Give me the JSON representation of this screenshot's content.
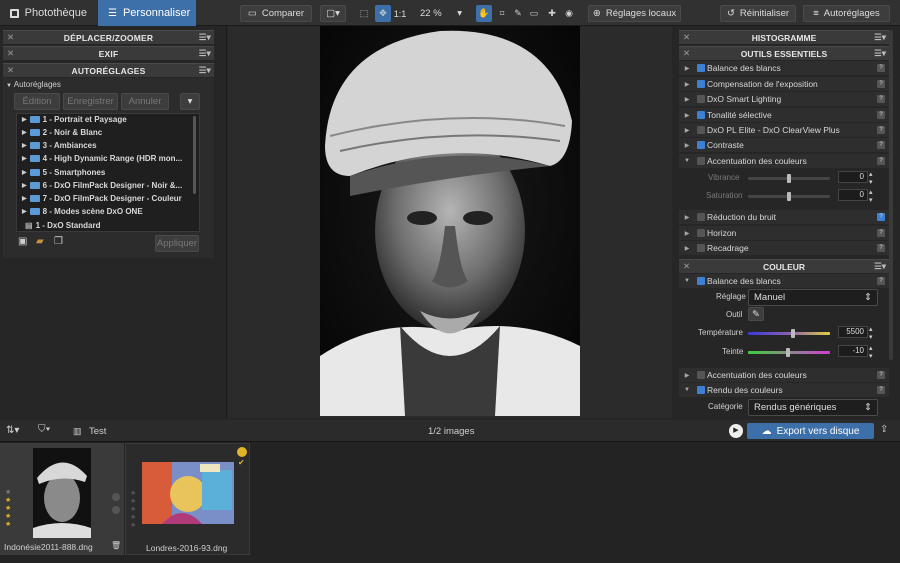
{
  "tabs": {
    "library": "Photothèque",
    "customize": "Personnaliser"
  },
  "toolbar": {
    "compare": "Comparer",
    "one_to_one": "1:1",
    "zoom": "22 %",
    "local": "Réglages locaux",
    "reset": "Réinitialiser",
    "auto": "Autoréglages"
  },
  "left": {
    "move_zoom": "DÉPLACER/ZOOMER",
    "exif": "EXIF",
    "autosettings": "AUTORÉGLAGES",
    "tree_root": "Autoréglages",
    "edit": "Édition",
    "save": "Enregistrer",
    "cancel": "Annuler",
    "presets": [
      "1 - Portrait et Paysage",
      "2 - Noir & Blanc",
      "3 - Ambiances",
      "4 - High Dynamic Range (HDR mon...",
      "5 - Smartphones",
      "6 - DxO FilmPack Designer - Noir &...",
      "7 - DxO FilmPack Designer - Couleur",
      "8 - Modes scène DxO ONE",
      "1 - DxO Standard"
    ],
    "apply": "Appliquer"
  },
  "right": {
    "histogram": "HISTOGRAMME",
    "essentials": "OUTILS ESSENTIELS",
    "ess_rows": [
      "Balance des blancs",
      "Compensation de l'exposition",
      "DxO Smart Lighting",
      "Tonalité sélective",
      "DxO PL Elite - DxO ClearView Plus",
      "Contraste",
      "Accentuation des couleurs"
    ],
    "vibrance": "Vibrance",
    "vibrance_val": "0",
    "saturation": "Saturation",
    "saturation_val": "0",
    "ess_rows2": [
      "Réduction du bruit",
      "Horizon",
      "Recadrage"
    ],
    "color": "COULEUR",
    "wb": "Balance des blancs",
    "reglage": "Réglage",
    "reglage_val": "Manuel",
    "outil": "Outil",
    "temperature": "Température",
    "temperature_val": "5500",
    "teinte": "Teinte",
    "teinte_val": "-10",
    "accent": "Accentuation des couleurs",
    "rendu": "Rendu des couleurs",
    "categorie": "Catégorie",
    "categorie_val": "Rendus génériques"
  },
  "filmstrip": {
    "filter": "Test",
    "count": "1/2 images",
    "export": "Export vers disque",
    "items": [
      {
        "name": "Indonésie2011-888.dng"
      },
      {
        "name": "Londres-2016-93.dng"
      }
    ]
  }
}
